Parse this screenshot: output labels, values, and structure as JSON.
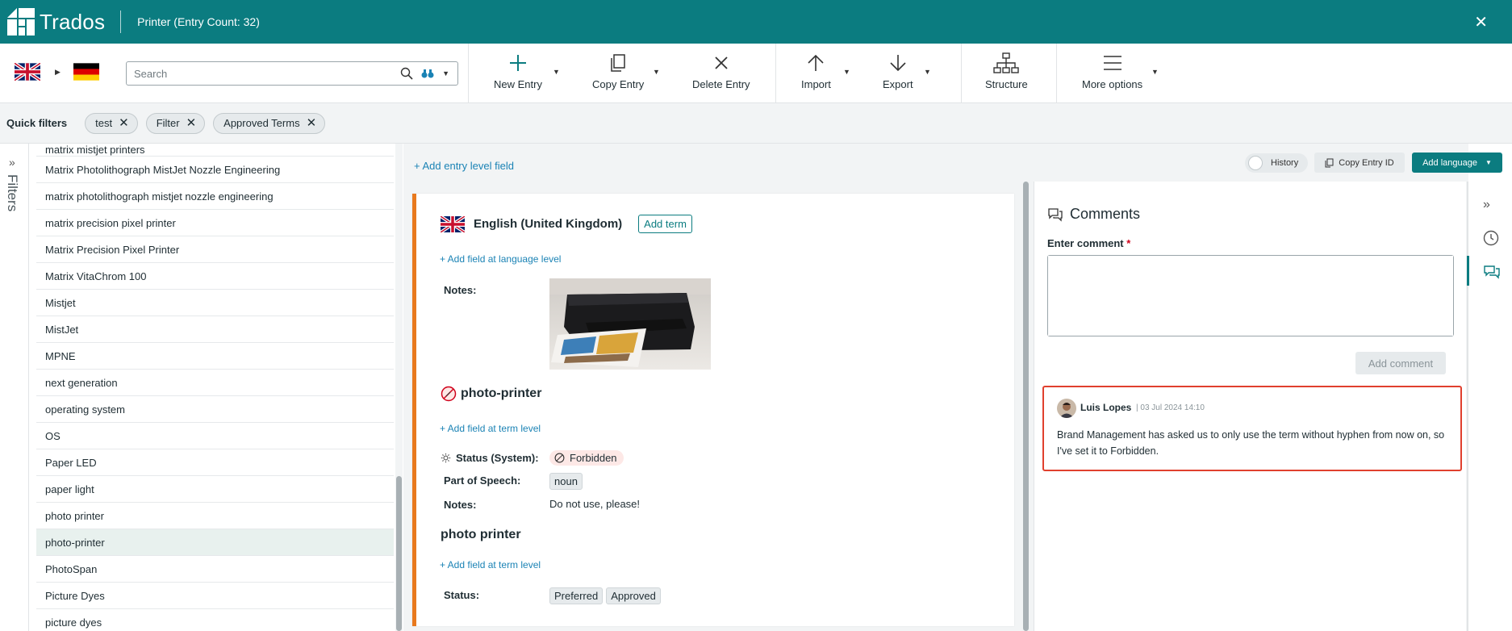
{
  "app": {
    "logo_text": "Trados",
    "title": "Printer (Entry Count: 32)",
    "brand_color": "#0b7c80"
  },
  "toolbar": {
    "search_placeholder": "Search",
    "new_entry": "New Entry",
    "copy_entry": "Copy Entry",
    "delete_entry": "Delete Entry",
    "import": "Import",
    "export": "Export",
    "structure": "Structure",
    "more_options": "More options"
  },
  "quick_filters": {
    "label": "Quick filters",
    "chips": [
      "test",
      "Filter",
      "Approved Terms"
    ]
  },
  "filters_rail": {
    "label": "Filters"
  },
  "term_list": {
    "items": [
      "matrix mistjet printers",
      "Matrix Photolithograph MistJet Nozzle Engineering",
      "matrix photolithograph mistjet nozzle engineering",
      "matrix precision pixel printer",
      "Matrix Precision Pixel Printer",
      "Matrix VitaChrom 100",
      "Mistjet",
      "MistJet",
      "MPNE",
      "next generation",
      "operating system",
      "OS",
      "Paper LED",
      "paper light",
      "photo printer",
      "photo-printer",
      "PhotoSpan",
      "Picture Dyes",
      "picture dyes"
    ],
    "selected": "photo-printer"
  },
  "entry": {
    "add_entry_field": "+ Add entry level field",
    "history": "History",
    "copy_entry_id": "Copy Entry ID",
    "add_language": "Add language",
    "language": "English (United Kingdom)",
    "add_term": "Add term",
    "add_language_field": "+ Add field at language level",
    "notes_label": "Notes:",
    "term1": {
      "name": "photo-printer",
      "add_field": "+ Add field at term level",
      "status_label": "Status (System):",
      "status_value": "Forbidden",
      "pos_label": "Part of Speech:",
      "pos_value": "noun",
      "notes_label": "Notes:",
      "notes_value": "Do not use, please!"
    },
    "term2": {
      "name": "photo printer",
      "add_field": "+ Add field at term level",
      "status_label": "Status:",
      "status_values": [
        "Preferred",
        "Approved"
      ]
    },
    "accent_color": "#e8791e"
  },
  "comments": {
    "title": "Comments",
    "enter_label": "Enter comment",
    "required_mark": "*",
    "add_button": "Add comment",
    "items": [
      {
        "author": "Luis Lopes",
        "date": "03 Jul 2024 14:10",
        "text": "Brand Management has asked us to only use the term without hyphen from now on, so I've set it to Forbidden."
      }
    ]
  }
}
